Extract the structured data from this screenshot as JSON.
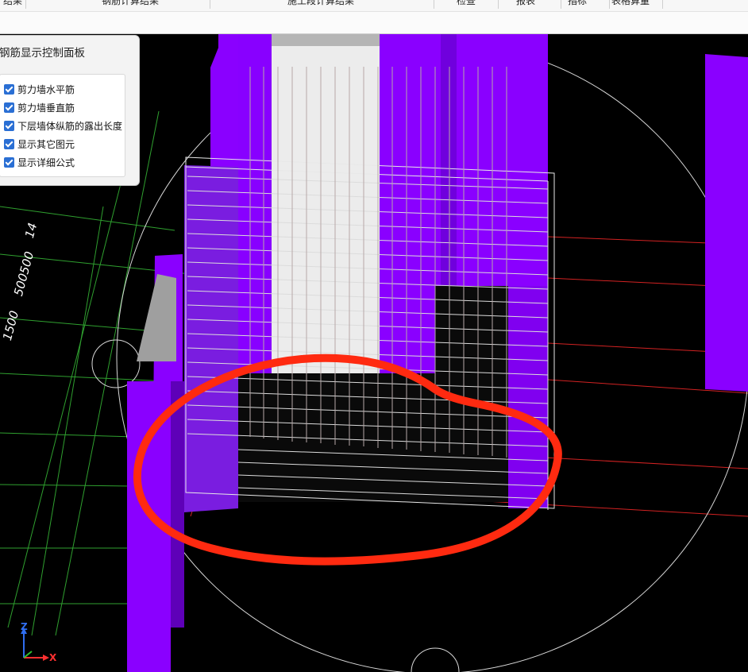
{
  "toolbar": {
    "tabs": [
      {
        "id": "t1",
        "label": "结果"
      },
      {
        "id": "t2",
        "label": "钢筋计算结果"
      },
      {
        "id": "t3",
        "label": "施工段计算结果"
      },
      {
        "id": "t4",
        "label": "检查"
      },
      {
        "id": "t5",
        "label": "报表"
      },
      {
        "id": "t6",
        "label": "指标"
      },
      {
        "id": "t7",
        "label": "表格算量"
      }
    ]
  },
  "panel": {
    "title": "钢筋显示控制面板",
    "options": [
      {
        "label": "剪力墙水平筋",
        "checked": true
      },
      {
        "label": "剪力墙垂直筋",
        "checked": true
      },
      {
        "label": "下层墙体纵筋的露出长度",
        "checked": true
      },
      {
        "label": "显示其它图元",
        "checked": true
      },
      {
        "label": "显示详细公式",
        "checked": true
      }
    ]
  },
  "dimensions": {
    "d1": "14",
    "d2": "500500",
    "d3": "1500"
  },
  "axis": {
    "z": "Z",
    "x": "X"
  },
  "colors": {
    "wall": "#8a00ff",
    "wallDark": "#6a00cc",
    "gridGreen": "#2fa02f",
    "redLine": "#d22222",
    "annotation": "#ff2a10"
  }
}
